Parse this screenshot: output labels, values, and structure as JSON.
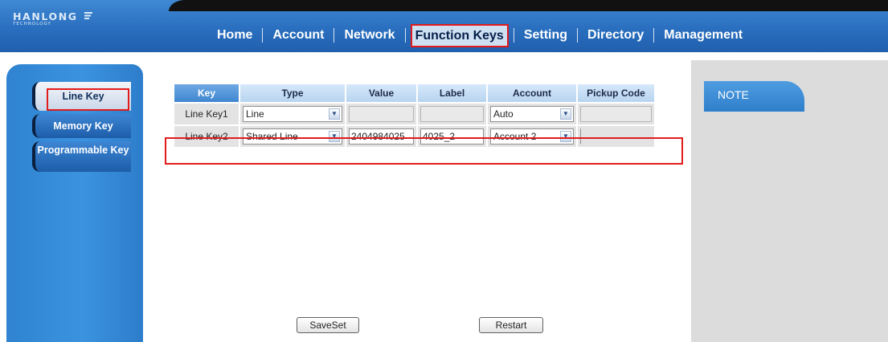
{
  "brand": {
    "name": "HANLONG",
    "tagline": "TECHNOLOGY"
  },
  "nav": {
    "items": [
      {
        "label": "Home"
      },
      {
        "label": "Account"
      },
      {
        "label": "Network"
      },
      {
        "label": "Function Keys",
        "active": true
      },
      {
        "label": "Setting"
      },
      {
        "label": "Directory"
      },
      {
        "label": "Management"
      }
    ]
  },
  "sidebar": {
    "items": [
      {
        "label": "Line Key",
        "active": true
      },
      {
        "label": "Memory Key"
      },
      {
        "label": "Programmable Key"
      }
    ]
  },
  "table": {
    "headers": [
      "Key",
      "Type",
      "Value",
      "Label",
      "Account",
      "Pickup Code"
    ],
    "rows": [
      {
        "key": "Line Key1",
        "type": "Line",
        "value": "",
        "label": "",
        "account": "Auto",
        "pickup_code": ""
      },
      {
        "key": "Line Key2",
        "type": "Shared Line",
        "value": "2404984025",
        "label": "4025_2",
        "account": "Account 2",
        "pickup_code": ""
      }
    ]
  },
  "buttons": {
    "save": "SaveSet",
    "restart": "Restart"
  },
  "note": {
    "title": "NOTE"
  },
  "colors": {
    "header_blue": "#2a6fbf",
    "highlight_red": "#e21b1b",
    "panel_gray": "#dcdcdc"
  }
}
